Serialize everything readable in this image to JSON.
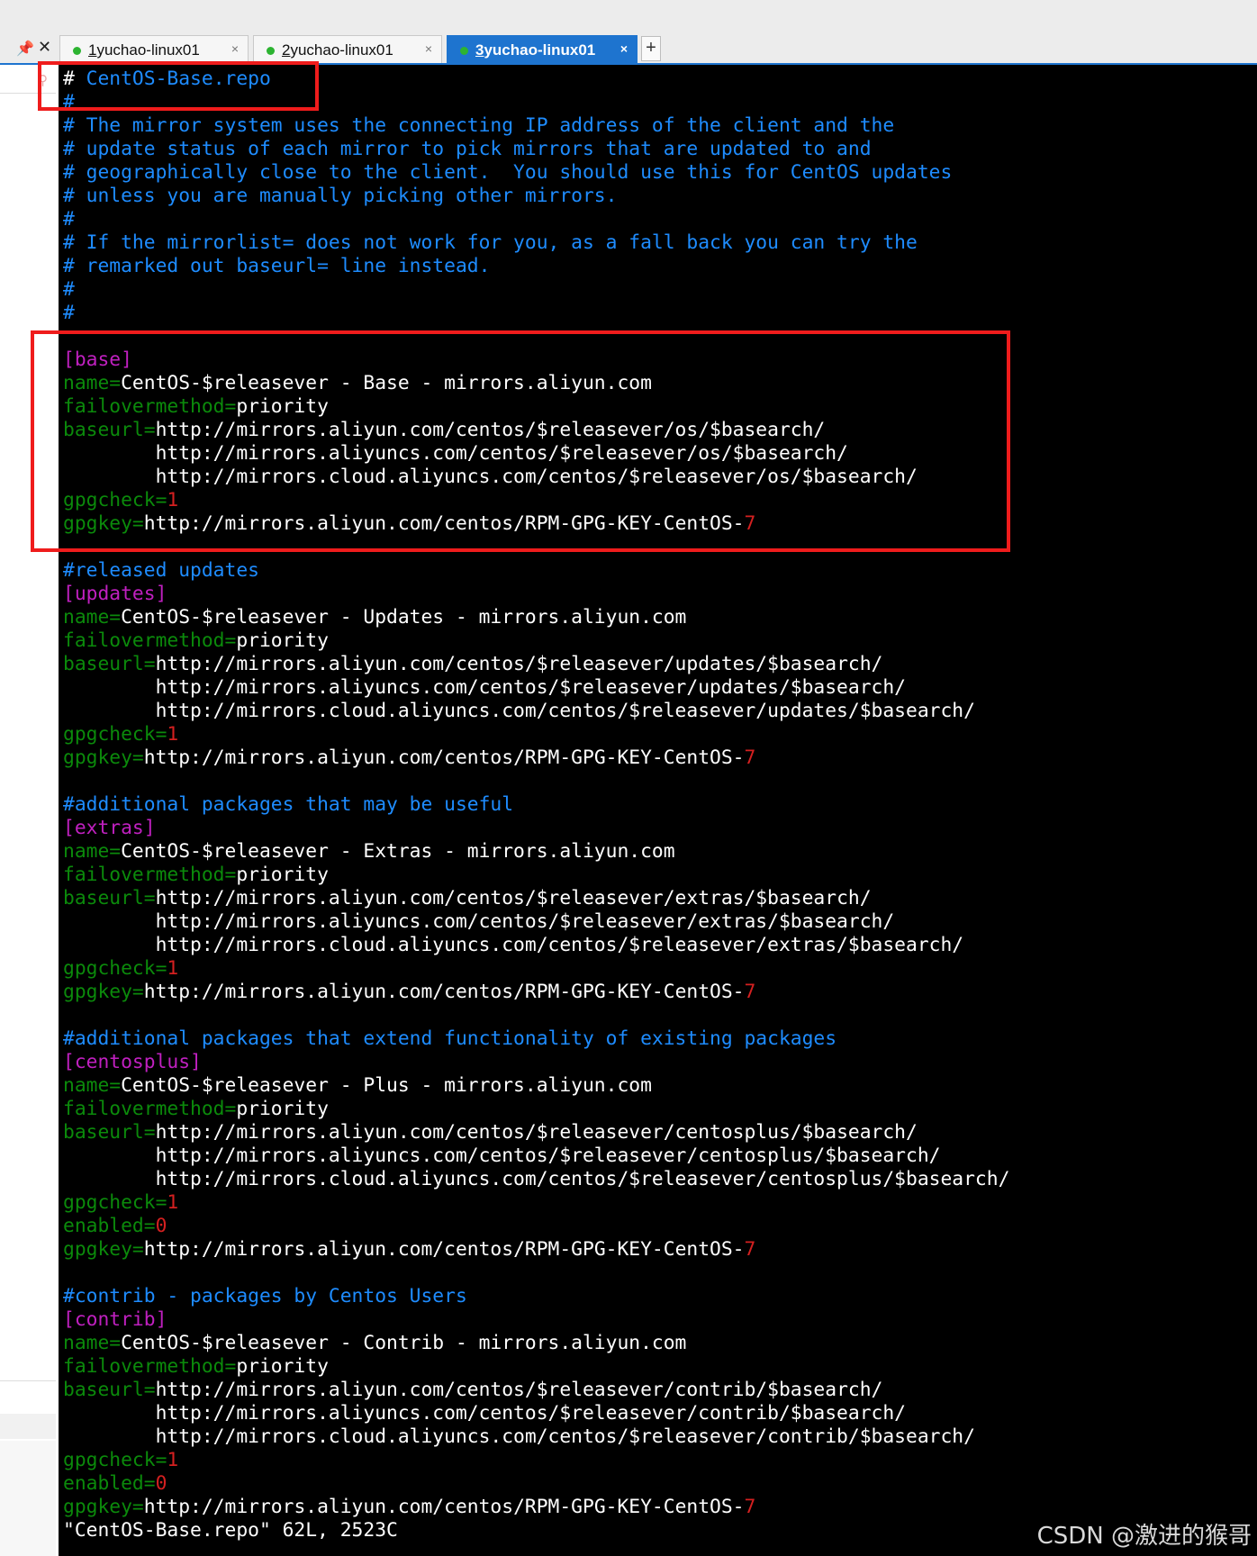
{
  "tabbar": {
    "pin_icon": "pin-icon",
    "close_icon": "close-icon",
    "tabs": [
      {
        "number": "1",
        "label": " yuchao-linux01",
        "close": "×"
      },
      {
        "number": "2",
        "label": " yuchao-linux01",
        "close": "×"
      },
      {
        "number": "3",
        "label": " yuchao-linux01",
        "close": "×"
      }
    ],
    "add_label": "+"
  },
  "terminal": {
    "lines": [
      [
        {
          "t": "#",
          "c": "cursor"
        },
        {
          "t": " CentOS-Base.repo",
          "c": "comment"
        }
      ],
      [
        {
          "t": "#",
          "c": "comment"
        }
      ],
      [
        {
          "t": "# The mirror system uses the connecting IP address of the client and the",
          "c": "comment"
        }
      ],
      [
        {
          "t": "# update status of each mirror to pick mirrors that are updated to and",
          "c": "comment"
        }
      ],
      [
        {
          "t": "# geographically close to the client.  You should use this for CentOS updates",
          "c": "comment"
        }
      ],
      [
        {
          "t": "# unless you are manually picking other mirrors.",
          "c": "comment"
        }
      ],
      [
        {
          "t": "#",
          "c": "comment"
        }
      ],
      [
        {
          "t": "# If the mirrorlist= does not work for you, as a fall back you can try the",
          "c": "comment"
        }
      ],
      [
        {
          "t": "# remarked out baseurl= line instead.",
          "c": "comment"
        }
      ],
      [
        {
          "t": "#",
          "c": "comment"
        }
      ],
      [
        {
          "t": "#",
          "c": "comment"
        }
      ],
      [],
      [
        {
          "t": "[base]",
          "c": "section"
        }
      ],
      [
        {
          "t": "name=",
          "c": "key"
        },
        {
          "t": "CentOS-$releasever - Base - mirrors.aliyun.com",
          "c": "val"
        }
      ],
      [
        {
          "t": "failovermethod=",
          "c": "key"
        },
        {
          "t": "priority",
          "c": "val"
        }
      ],
      [
        {
          "t": "baseurl=",
          "c": "key"
        },
        {
          "t": "http://mirrors.aliyun.com/centos/$releasever/os/$basearch/",
          "c": "val"
        }
      ],
      [
        {
          "t": "        http://mirrors.aliyuncs.com/centos/$releasever/os/$basearch/",
          "c": "val"
        }
      ],
      [
        {
          "t": "        http://mirrors.cloud.aliyuncs.com/centos/$releasever/os/$basearch/",
          "c": "val"
        }
      ],
      [
        {
          "t": "gpgcheck=",
          "c": "key"
        },
        {
          "t": "1",
          "c": "num"
        }
      ],
      [
        {
          "t": "gpgkey=",
          "c": "key"
        },
        {
          "t": "http://mirrors.aliyun.com/centos/RPM-GPG-KEY-CentOS-",
          "c": "val"
        },
        {
          "t": "7",
          "c": "num"
        }
      ],
      [],
      [
        {
          "t": "#released updates",
          "c": "comment"
        }
      ],
      [
        {
          "t": "[updates]",
          "c": "section"
        }
      ],
      [
        {
          "t": "name=",
          "c": "key"
        },
        {
          "t": "CentOS-$releasever - Updates - mirrors.aliyun.com",
          "c": "val"
        }
      ],
      [
        {
          "t": "failovermethod=",
          "c": "key"
        },
        {
          "t": "priority",
          "c": "val"
        }
      ],
      [
        {
          "t": "baseurl=",
          "c": "key"
        },
        {
          "t": "http://mirrors.aliyun.com/centos/$releasever/updates/$basearch/",
          "c": "val"
        }
      ],
      [
        {
          "t": "        http://mirrors.aliyuncs.com/centos/$releasever/updates/$basearch/",
          "c": "val"
        }
      ],
      [
        {
          "t": "        http://mirrors.cloud.aliyuncs.com/centos/$releasever/updates/$basearch/",
          "c": "val"
        }
      ],
      [
        {
          "t": "gpgcheck=",
          "c": "key"
        },
        {
          "t": "1",
          "c": "num"
        }
      ],
      [
        {
          "t": "gpgkey=",
          "c": "key"
        },
        {
          "t": "http://mirrors.aliyun.com/centos/RPM-GPG-KEY-CentOS-",
          "c": "val"
        },
        {
          "t": "7",
          "c": "num"
        }
      ],
      [],
      [
        {
          "t": "#additional packages that may be useful",
          "c": "comment"
        }
      ],
      [
        {
          "t": "[extras]",
          "c": "section"
        }
      ],
      [
        {
          "t": "name=",
          "c": "key"
        },
        {
          "t": "CentOS-$releasever - Extras - mirrors.aliyun.com",
          "c": "val"
        }
      ],
      [
        {
          "t": "failovermethod=",
          "c": "key"
        },
        {
          "t": "priority",
          "c": "val"
        }
      ],
      [
        {
          "t": "baseurl=",
          "c": "key"
        },
        {
          "t": "http://mirrors.aliyun.com/centos/$releasever/extras/$basearch/",
          "c": "val"
        }
      ],
      [
        {
          "t": "        http://mirrors.aliyuncs.com/centos/$releasever/extras/$basearch/",
          "c": "val"
        }
      ],
      [
        {
          "t": "        http://mirrors.cloud.aliyuncs.com/centos/$releasever/extras/$basearch/",
          "c": "val"
        }
      ],
      [
        {
          "t": "gpgcheck=",
          "c": "key"
        },
        {
          "t": "1",
          "c": "num"
        }
      ],
      [
        {
          "t": "gpgkey=",
          "c": "key"
        },
        {
          "t": "http://mirrors.aliyun.com/centos/RPM-GPG-KEY-CentOS-",
          "c": "val"
        },
        {
          "t": "7",
          "c": "num"
        }
      ],
      [],
      [
        {
          "t": "#additional packages that extend functionality of existing packages",
          "c": "comment"
        }
      ],
      [
        {
          "t": "[centosplus]",
          "c": "section"
        }
      ],
      [
        {
          "t": "name=",
          "c": "key"
        },
        {
          "t": "CentOS-$releasever - Plus - mirrors.aliyun.com",
          "c": "val"
        }
      ],
      [
        {
          "t": "failovermethod=",
          "c": "key"
        },
        {
          "t": "priority",
          "c": "val"
        }
      ],
      [
        {
          "t": "baseurl=",
          "c": "key"
        },
        {
          "t": "http://mirrors.aliyun.com/centos/$releasever/centosplus/$basearch/",
          "c": "val"
        }
      ],
      [
        {
          "t": "        http://mirrors.aliyuncs.com/centos/$releasever/centosplus/$basearch/",
          "c": "val"
        }
      ],
      [
        {
          "t": "        http://mirrors.cloud.aliyuncs.com/centos/$releasever/centosplus/$basearch/",
          "c": "val"
        }
      ],
      [
        {
          "t": "gpgcheck=",
          "c": "key"
        },
        {
          "t": "1",
          "c": "num"
        }
      ],
      [
        {
          "t": "enabled=",
          "c": "key"
        },
        {
          "t": "0",
          "c": "num"
        }
      ],
      [
        {
          "t": "gpgkey=",
          "c": "key"
        },
        {
          "t": "http://mirrors.aliyun.com/centos/RPM-GPG-KEY-CentOS-",
          "c": "val"
        },
        {
          "t": "7",
          "c": "num"
        }
      ],
      [],
      [
        {
          "t": "#contrib - packages by Centos Users",
          "c": "comment"
        }
      ],
      [
        {
          "t": "[contrib]",
          "c": "section"
        }
      ],
      [
        {
          "t": "name=",
          "c": "key"
        },
        {
          "t": "CentOS-$releasever - Contrib - mirrors.aliyun.com",
          "c": "val"
        }
      ],
      [
        {
          "t": "failovermethod=",
          "c": "key"
        },
        {
          "t": "priority",
          "c": "val"
        }
      ],
      [
        {
          "t": "baseurl=",
          "c": "key"
        },
        {
          "t": "http://mirrors.aliyun.com/centos/$releasever/contrib/$basearch/",
          "c": "val"
        }
      ],
      [
        {
          "t": "        http://mirrors.aliyuncs.com/centos/$releasever/contrib/$basearch/",
          "c": "val"
        }
      ],
      [
        {
          "t": "        http://mirrors.cloud.aliyuncs.com/centos/$releasever/contrib/$basearch/",
          "c": "val"
        }
      ],
      [
        {
          "t": "gpgcheck=",
          "c": "key"
        },
        {
          "t": "1",
          "c": "num"
        }
      ],
      [
        {
          "t": "enabled=",
          "c": "key"
        },
        {
          "t": "0",
          "c": "num"
        }
      ],
      [
        {
          "t": "gpgkey=",
          "c": "key"
        },
        {
          "t": "http://mirrors.aliyun.com/centos/RPM-GPG-KEY-CentOS-",
          "c": "val"
        },
        {
          "t": "7",
          "c": "num"
        }
      ],
      [
        {
          "t": "\"CentOS-Base.repo\" 62L, 2523C",
          "c": "val"
        }
      ]
    ]
  },
  "colors": {
    "terminal_bg": "#000000",
    "comment": "#1e8cff",
    "section": "#c020c0",
    "key": "#0b8a0b",
    "number": "#d42020",
    "annotation_box": "#ef1c1c",
    "active_tab": "#1e74cf"
  },
  "watermark": "CSDN @激进的猴哥"
}
